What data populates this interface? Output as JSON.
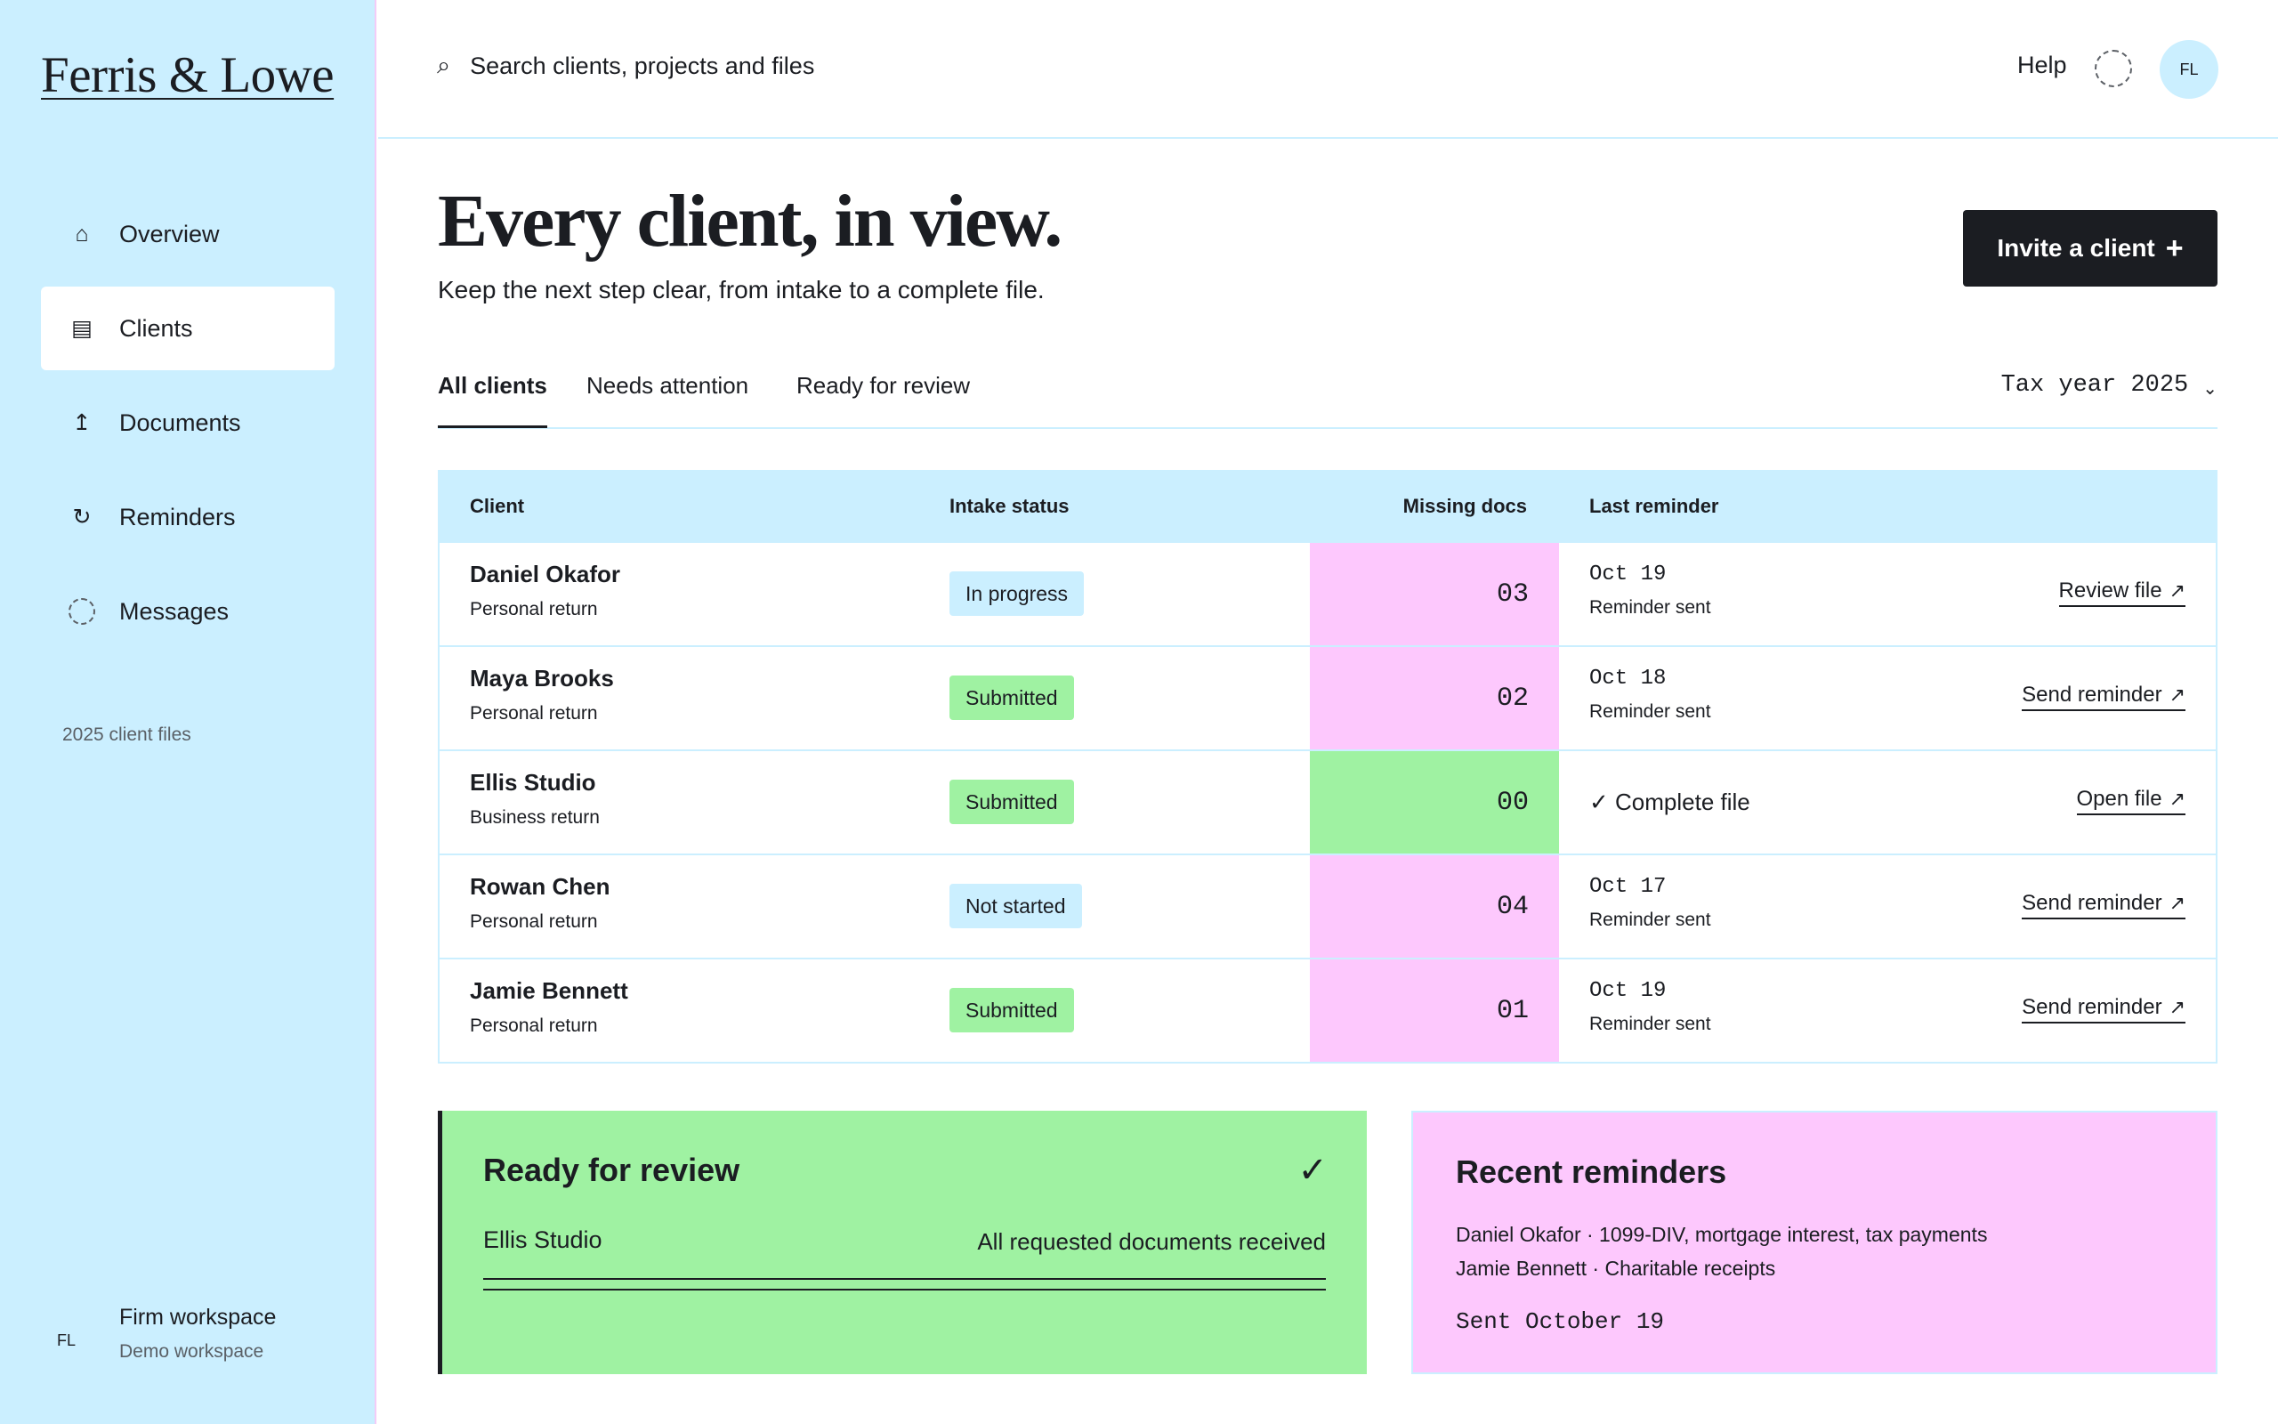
{
  "brand": {
    "logo": "Ferris & Lowe"
  },
  "sidebar": {
    "items": [
      {
        "label": "Overview",
        "icon": "home-icon",
        "glyph": "⌂"
      },
      {
        "label": "Clients",
        "icon": "list-icon",
        "glyph": "▤",
        "active": true
      },
      {
        "label": "Documents",
        "icon": "upload-icon",
        "glyph": "↥"
      },
      {
        "label": "Reminders",
        "icon": "refresh-icon",
        "glyph": "↻"
      },
      {
        "label": "Messages",
        "icon": "message-ring-icon"
      }
    ],
    "note": "2025 client files",
    "workspace": {
      "initials": "FL",
      "title": "Firm workspace",
      "subtitle": "Demo workspace"
    }
  },
  "topbar": {
    "search_placeholder": "Search clients, projects and files",
    "help": "Help",
    "avatar_initials": "FL"
  },
  "page": {
    "title": "Every client, in view.",
    "subtitle": "Keep the next step clear, from intake to a complete file.",
    "invite_label": "Invite a client",
    "invite_plus": "+"
  },
  "tabs": [
    {
      "label": "All clients",
      "active": true
    },
    {
      "label": "Needs attention"
    },
    {
      "label": "Ready for review"
    }
  ],
  "filter": {
    "tax_year": "Tax year 2025",
    "chevron": "⌄"
  },
  "table": {
    "headers": {
      "client": "Client",
      "intake": "Intake status",
      "missing": "Missing docs",
      "reminder": "Last reminder"
    },
    "rows": [
      {
        "name": "Daniel Okafor",
        "type": "Personal return",
        "status": "In progress",
        "status_color": "blue",
        "missing": "03",
        "missing_color": "pink",
        "date": "Oct 19",
        "reminder": "Reminder sent",
        "action": "Review file"
      },
      {
        "name": "Maya Brooks",
        "type": "Personal return",
        "status": "Submitted",
        "status_color": "green",
        "missing": "02",
        "missing_color": "pink",
        "date": "Oct 18",
        "reminder": "Reminder sent",
        "action": "Send reminder"
      },
      {
        "name": "Ellis Studio",
        "type": "Business return",
        "status": "Submitted",
        "status_color": "green",
        "missing": "00",
        "missing_color": "green",
        "complete": "✓ Complete file",
        "action": "Open file"
      },
      {
        "name": "Rowan Chen",
        "type": "Personal return",
        "status": "Not started",
        "status_color": "blue",
        "missing": "04",
        "missing_color": "pink",
        "date": "Oct 17",
        "reminder": "Reminder sent",
        "action": "Send reminder"
      },
      {
        "name": "Jamie Bennett",
        "type": "Personal return",
        "status": "Submitted",
        "status_color": "green",
        "missing": "01",
        "missing_color": "pink",
        "date": "Oct 19",
        "reminder": "Reminder sent",
        "action": "Send reminder"
      }
    ]
  },
  "review_panel": {
    "title": "Ready for review",
    "check": "✓",
    "client": "Ellis Studio",
    "note": "All requested documents received"
  },
  "reminders_panel": {
    "title": "Recent reminders",
    "lines": [
      "Daniel Okafor · 1099-DIV, mortgage interest, tax payments",
      "Jamie Bennett · Charitable receipts"
    ],
    "sent": "Sent October 19"
  },
  "colors": {
    "sky": "#cbefff",
    "pink": "#fdc8fd",
    "green": "#9ff2a2",
    "ink": "#1b1d22"
  }
}
